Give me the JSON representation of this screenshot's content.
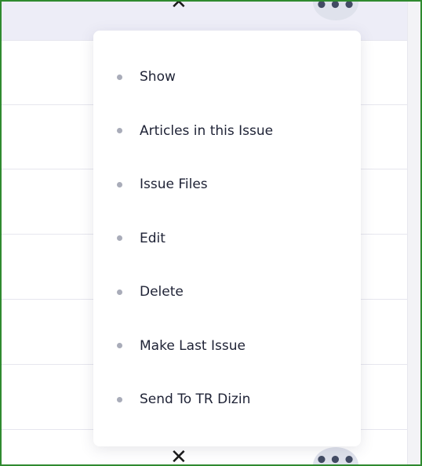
{
  "menu": {
    "items": [
      {
        "label": "Show"
      },
      {
        "label": "Articles in this Issue"
      },
      {
        "label": "Issue Files"
      },
      {
        "label": "Edit"
      },
      {
        "label": "Delete"
      },
      {
        "label": "Make Last Issue"
      },
      {
        "label": "Send To TR Dizin"
      }
    ]
  },
  "row_controls": {
    "close_glyph": "✕",
    "more_glyph": "•••"
  },
  "icons": {
    "close": "close-icon",
    "more": "more-options-icon"
  },
  "colors": {
    "frame_border": "#2f8a2f",
    "highlight_row": "#ededf7",
    "bullet": "#a9acb9",
    "menu_text": "#1e2235"
  }
}
